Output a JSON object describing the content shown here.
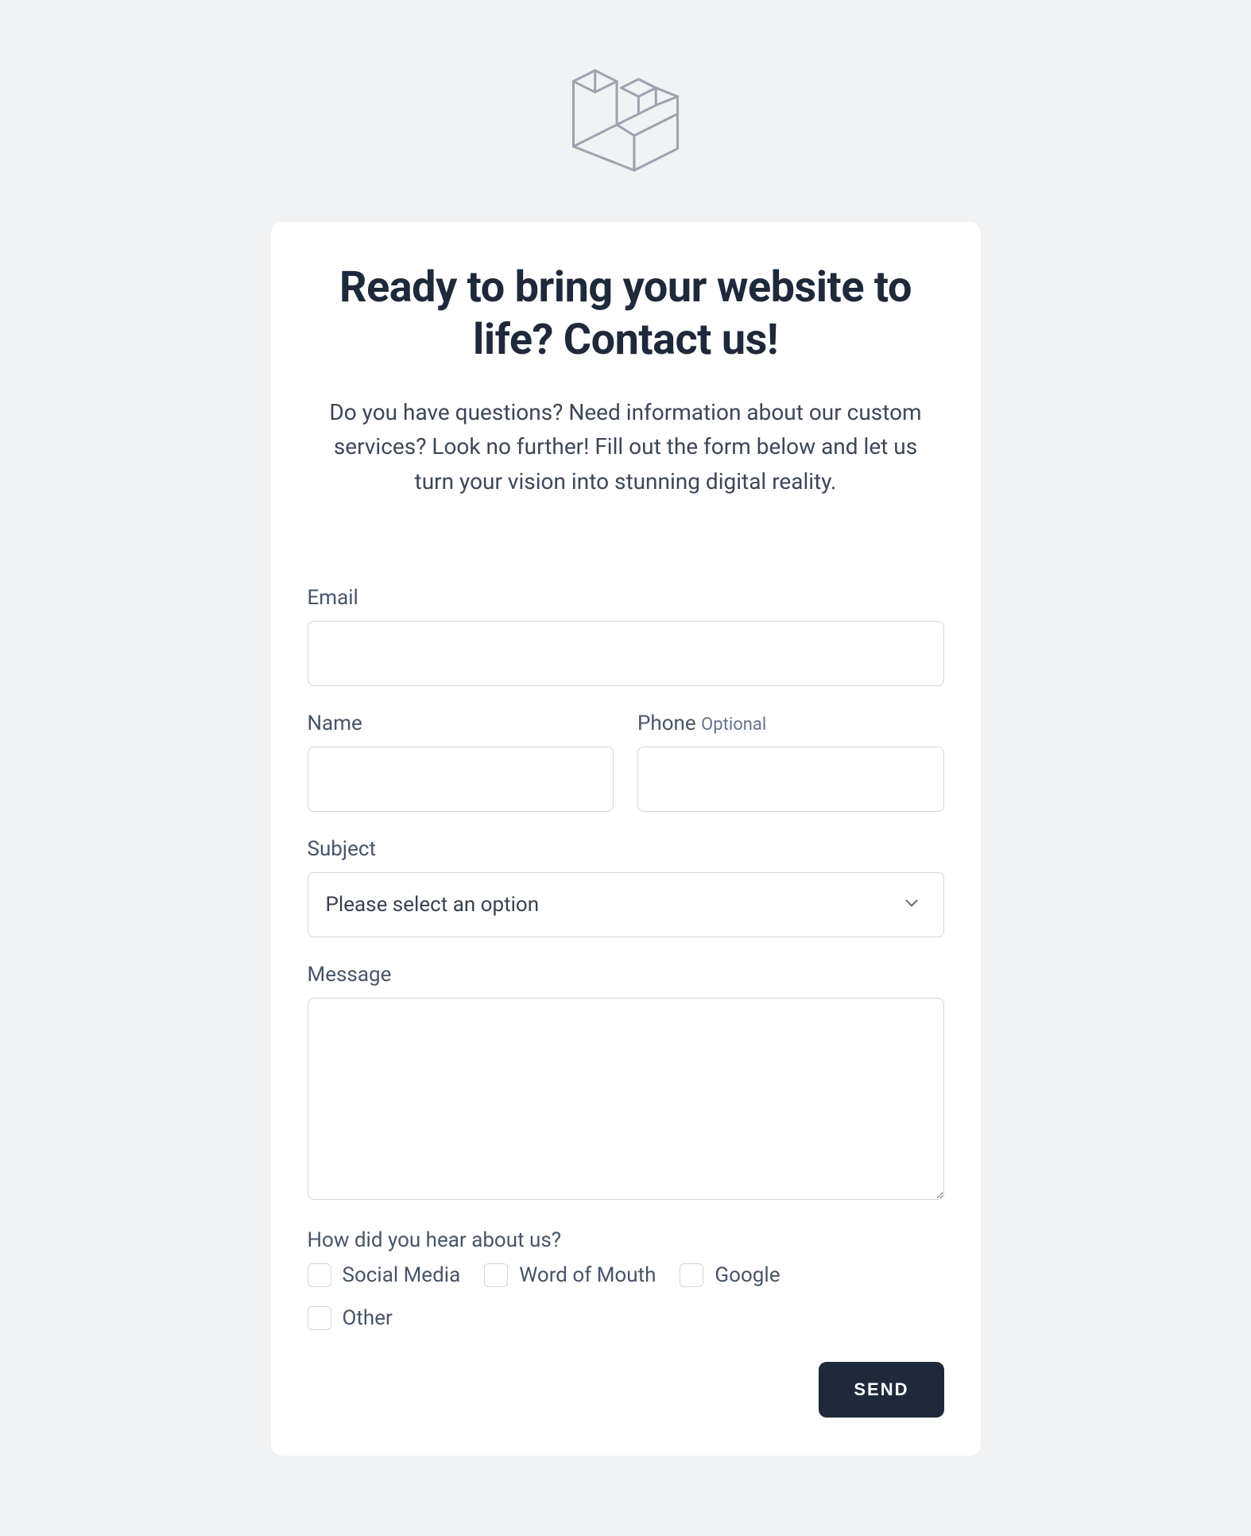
{
  "heading": "Ready to bring your website to life? Contact us!",
  "subheading": "Do you have questions? Need information about our custom services? Look no further! Fill out the form below and let us turn your vision into stunning digital reality.",
  "form": {
    "email": {
      "label": "Email",
      "value": ""
    },
    "name": {
      "label": "Name",
      "value": ""
    },
    "phone": {
      "label": "Phone",
      "optional": "Optional",
      "value": ""
    },
    "subject": {
      "label": "Subject",
      "selected": "Please select an option"
    },
    "message": {
      "label": "Message",
      "value": ""
    },
    "heard": {
      "label": "How did you hear about us?",
      "options": [
        "Social Media",
        "Word of Mouth",
        "Google",
        "Other"
      ]
    },
    "submit_label": "SEND"
  },
  "icons": {
    "logo": "laravel-logo-icon",
    "chevron": "chevron-down-icon"
  },
  "colors": {
    "bg": "#f1f2f4",
    "card": "#ffffff",
    "text_primary": "#1e293b",
    "text_secondary": "#475569",
    "border": "#d1d5db",
    "button": "#1e293b"
  }
}
